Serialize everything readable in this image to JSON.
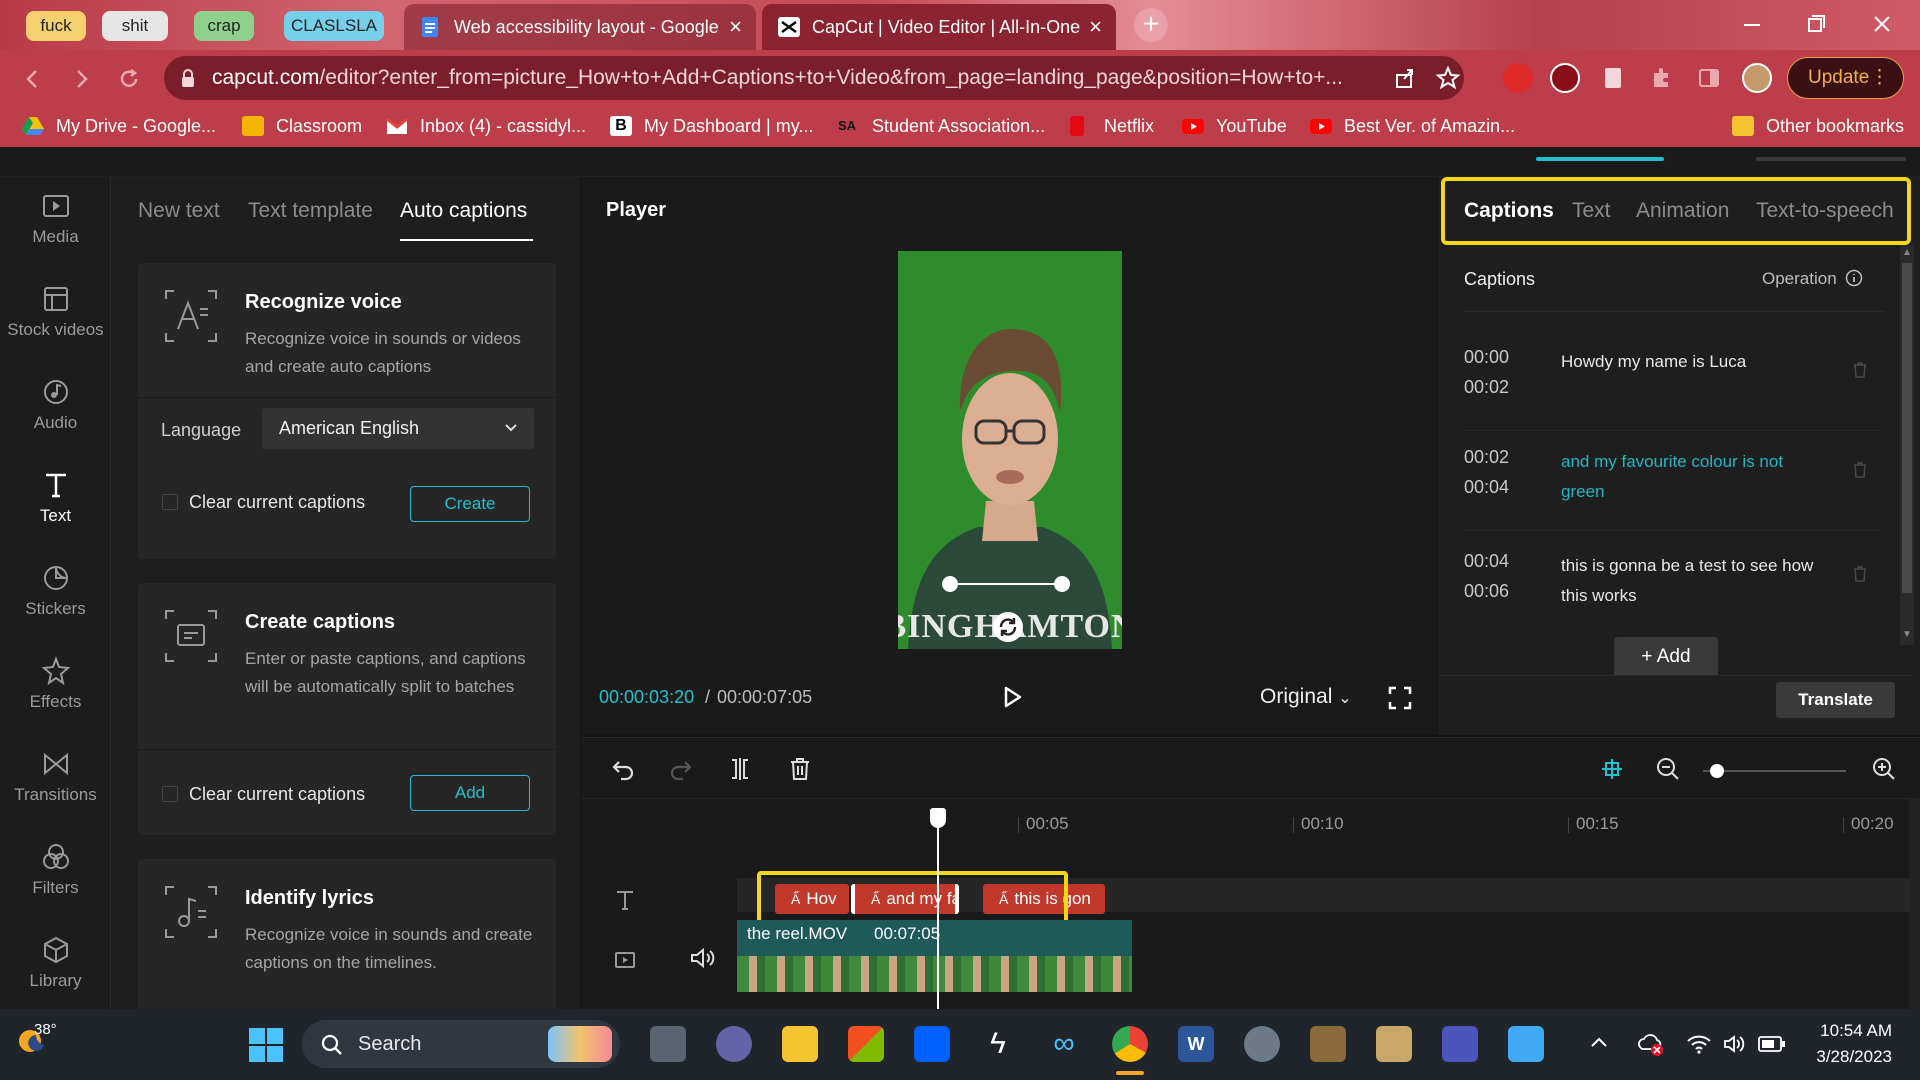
{
  "browser": {
    "pills": [
      {
        "label": "fuck",
        "color": "#f4d06f"
      },
      {
        "label": "shit",
        "color": "#e6e6e6"
      },
      {
        "label": "crap",
        "color": "#8fd18c"
      },
      {
        "label": "CLASLSLA",
        "color": "#76d0ea"
      }
    ],
    "tabs": [
      {
        "title": "Web accessibility layout - Google"
      },
      {
        "title": "CapCut | Video Editor | All-In-One"
      }
    ],
    "url_host": "capcut.com",
    "url_path": "/editor?enter_from=picture_How+to+Add+Captions+to+Video&from_page=landing_page&position=How+to+...",
    "update_label": "Update",
    "bookmarks": [
      {
        "label": "My Drive - Google...",
        "color": "#f4c20d"
      },
      {
        "label": "Classroom",
        "color": "#f5b400"
      },
      {
        "label": "Inbox (4) - cassidyl...",
        "color": "#ea4335"
      },
      {
        "label": "My Dashboard | my...",
        "color": "#ffffff"
      },
      {
        "label": "Student Association...",
        "color": "#222222"
      },
      {
        "label": "Netflix",
        "color": "#e50914"
      },
      {
        "label": "YouTube",
        "color": "#ff0000"
      },
      {
        "label": "Best Ver. of Amazin...",
        "color": "#ff0000"
      }
    ],
    "other_bookmarks": "Other bookmarks"
  },
  "leftnav": [
    {
      "label": "Media",
      "icon": "media-icon"
    },
    {
      "label": "Stock videos",
      "icon": "stock-videos-icon"
    },
    {
      "label": "Audio",
      "icon": "audio-icon"
    },
    {
      "label": "Text",
      "icon": "text-icon"
    },
    {
      "label": "Stickers",
      "icon": "stickers-icon"
    },
    {
      "label": "Effects",
      "icon": "effects-icon"
    },
    {
      "label": "Transitions",
      "icon": "transitions-icon"
    },
    {
      "label": "Filters",
      "icon": "filters-icon"
    },
    {
      "label": "Library",
      "icon": "library-icon"
    }
  ],
  "textpanel": {
    "tabs": [
      "New text",
      "Text template",
      "Auto captions"
    ],
    "recognize": {
      "title": "Recognize voice",
      "desc": "Recognize voice in sounds or videos and create auto captions",
      "language_label": "Language",
      "language_value": "American English",
      "clear_label": "Clear current captions",
      "button": "Create"
    },
    "create": {
      "title": "Create captions",
      "desc": "Enter or paste captions, and captions will be automatically split to batches",
      "clear_label": "Clear current captions",
      "button": "Add"
    },
    "lyrics": {
      "title": "Identify lyrics",
      "desc": "Recognize voice in sounds and create captions on the timelines."
    }
  },
  "player": {
    "title": "Player",
    "current_time": "00:00:03:20",
    "separator": "/",
    "total_time": "00:00:07:05",
    "ratio": "Original"
  },
  "captions_panel": {
    "tabs": [
      "Captions",
      "Text",
      "Animation",
      "Text-to-speech"
    ],
    "header": "Captions",
    "operation": "Operation",
    "rows": [
      {
        "start": "00:00",
        "end": "00:02",
        "text": "Howdy my name is Luca"
      },
      {
        "start": "00:02",
        "end": "00:04",
        "text": "and my favourite colour is not green"
      },
      {
        "start": "00:04",
        "end": "00:06",
        "text": "this is gonna be a test to see how this works"
      }
    ],
    "add_label": "+ Add",
    "translate_label": "Translate"
  },
  "timeline": {
    "ticks": [
      "00:05",
      "00:10",
      "00:15",
      "00:20"
    ],
    "caption_clips": [
      "Hov",
      "and my fa",
      "this is gon"
    ],
    "video_clip_name": "the reel.MOV",
    "video_clip_duration": "00:07:05"
  },
  "taskbar": {
    "temperature": "38°",
    "search_label": "Search",
    "time": "10:54 AM",
    "date": "3/28/2023"
  },
  "colors": {
    "accent": "#1fc1cf",
    "highlight": "#f2d716",
    "caption_clip": "#c0392b"
  }
}
